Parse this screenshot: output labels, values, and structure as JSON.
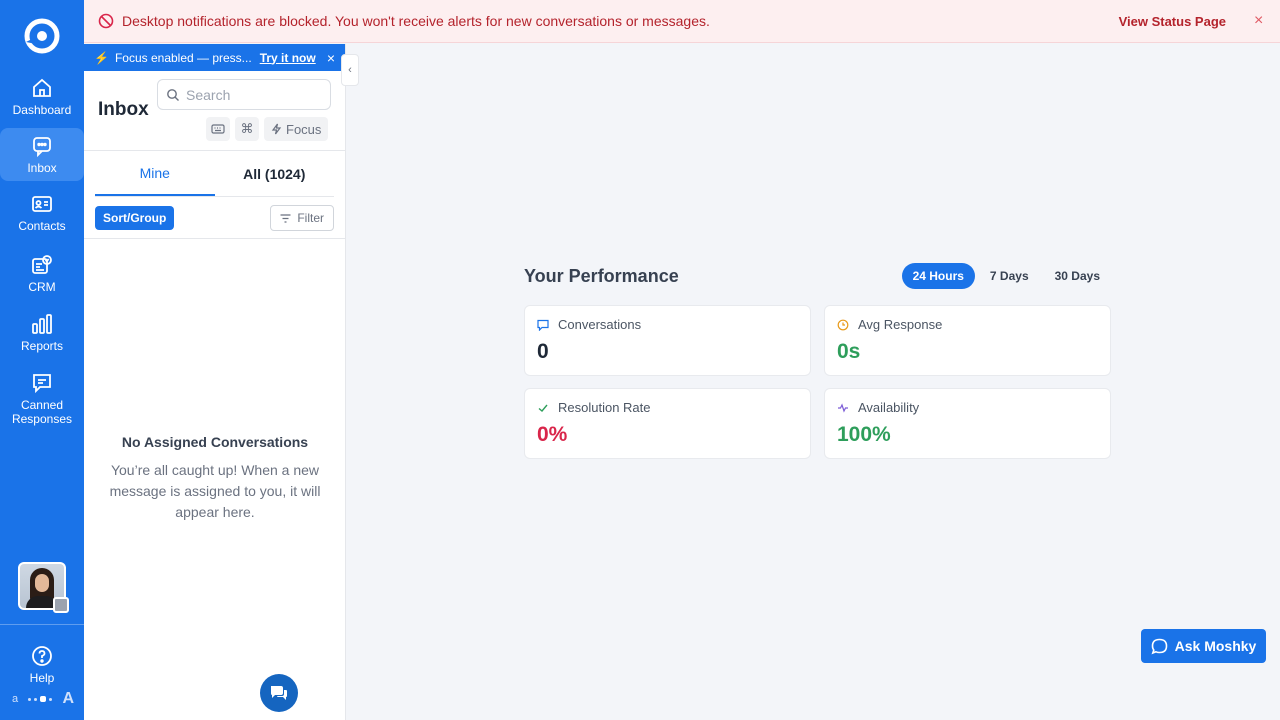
{
  "banner": {
    "message": "Desktop notifications are blocked. You won't receive alerts for new conversations or messages.",
    "link": "View Status Page",
    "close": "×"
  },
  "nav": {
    "items": [
      {
        "label": "Dashboard",
        "icon": "home-icon"
      },
      {
        "label": "Inbox",
        "icon": "chat-icon"
      },
      {
        "label": "Contacts",
        "icon": "contact-card-icon"
      },
      {
        "label": "CRM",
        "icon": "crm-icon"
      },
      {
        "label": "Reports",
        "icon": "bar-chart-icon"
      },
      {
        "label": "Canned Responses",
        "icon": "canned-message-icon"
      }
    ],
    "help": "Help",
    "font_small": "a",
    "font_large": "A",
    "accent": "#1a73e8"
  },
  "focus_strip": {
    "text": "Focus enabled — press...",
    "link": "Try it now",
    "close": "×"
  },
  "inbox": {
    "title": "Inbox",
    "search_placeholder": "Search",
    "shortcut_symbol": "⌘",
    "focus_label": "Focus",
    "tabs": [
      {
        "label": "Mine"
      },
      {
        "label": "All (1024)"
      }
    ],
    "sort_label": "Sort/Group",
    "filter_label": "Filter",
    "empty_title": "No Assigned Conversations",
    "empty_desc": "You’re all caught up! When a new message is assigned to you, it will appear here."
  },
  "performance": {
    "title": "Your Performance",
    "ranges": [
      "24 Hours",
      "7 Days",
      "30 Days"
    ],
    "active_range": "24 Hours",
    "cards": [
      {
        "label": "Conversations",
        "value": "0",
        "color": "#1f2937"
      },
      {
        "label": "Avg Response",
        "value": "0s",
        "color": "#2e9e5b"
      },
      {
        "label": "Resolution Rate",
        "value": "0%",
        "color": "#d9254a"
      },
      {
        "label": "Availability",
        "value": "100%",
        "color": "#2e9e5b"
      }
    ]
  },
  "ask": {
    "label": "Ask Moshky"
  }
}
